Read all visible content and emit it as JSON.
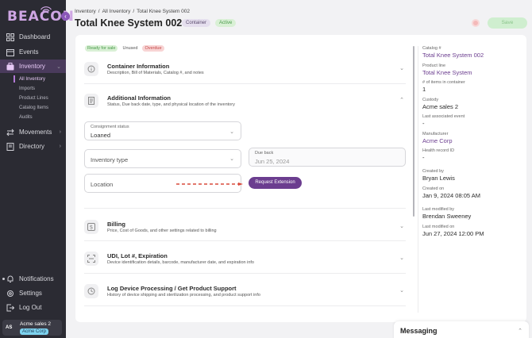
{
  "app": {
    "logo": "BEACON"
  },
  "sidebar": {
    "items": [
      {
        "label": "Dashboard",
        "icon": "grid-icon"
      },
      {
        "label": "Events",
        "icon": "calendar-icon"
      },
      {
        "label": "Inventory",
        "icon": "box-icon",
        "active": true
      },
      {
        "label": "Movements",
        "icon": "arrows-icon"
      },
      {
        "label": "Directory",
        "icon": "book-icon"
      }
    ],
    "inventory_sub": [
      "All Inventory",
      "Imports",
      "Product Lines",
      "Catalog Items",
      "Audits"
    ],
    "bottom": [
      {
        "label": "Notifications",
        "icon": "bell-icon"
      },
      {
        "label": "Settings",
        "icon": "gear-icon"
      },
      {
        "label": "Log Out",
        "icon": "logout-icon"
      }
    ],
    "user": {
      "initials": "AS",
      "name": "Acme sales 2",
      "org": "Acme Corp"
    }
  },
  "header": {
    "breadcrumb": [
      "Inventory",
      "/",
      "All Inventory",
      "/",
      "Total Knee System 002"
    ],
    "title": "Total Knee System 002",
    "badges": {
      "container": "Container",
      "active": "Active"
    },
    "save_label": "Save"
  },
  "tags": [
    "Ready for sale",
    "Unused",
    "Overdue"
  ],
  "sections": {
    "container": {
      "title": "Container Information",
      "desc": "Description, Bill of Materials, Catalog #, and notes"
    },
    "additional": {
      "title": "Additional Information",
      "desc": "Status, Due back date, type, and physical location of the inventory"
    },
    "billing": {
      "title": "Billing",
      "desc": "Price, Cost of Goods, and other settings related to billing"
    },
    "udi": {
      "title": "UDI, Lot #, Expiration",
      "desc": "Device identification details, barcode, manufacturer date, and expiration info"
    },
    "log": {
      "title": "Log Device Processing / Get Product Support",
      "desc": "History of device shipping and sterilization processing, and product support info"
    }
  },
  "form": {
    "consignment_label": "Consignment status",
    "consignment_value": "Loaned",
    "inventory_type_placeholder": "Inventory type",
    "due_back_label": "Due back",
    "due_back_value": "Jun 25, 2024",
    "location_placeholder": "Location",
    "request_extension": "Request Extension"
  },
  "details": [
    {
      "label": "Catalog #",
      "value": "Total Knee System 002",
      "link": true
    },
    {
      "label": "Product line",
      "value": "Total Knee System",
      "link": true
    },
    {
      "label": "# of items in container",
      "value": "1"
    },
    {
      "label": "Custody",
      "value": "Acme sales 2"
    },
    {
      "label": "Last associated event",
      "value": "-"
    },
    {
      "label": "Manufacturer",
      "value": "Acme Corp",
      "link": true
    },
    {
      "label": "Health record ID",
      "value": "-"
    },
    {
      "label": "Created by",
      "value": "Bryan Lewis"
    },
    {
      "label": "Created on",
      "value": "Jan 9, 2024 08:05 AM"
    },
    {
      "label": "Last modified by",
      "value": "Brendan Sweeney"
    },
    {
      "label": "Last modified on",
      "value": "Jun 27, 2024 12:00 PM"
    }
  ],
  "messaging": {
    "title": "Messaging"
  },
  "colors": {
    "sidebar_bg": "#2b2b33",
    "accent": "#6b3d8f",
    "active_nav": "#4a3b5c"
  }
}
